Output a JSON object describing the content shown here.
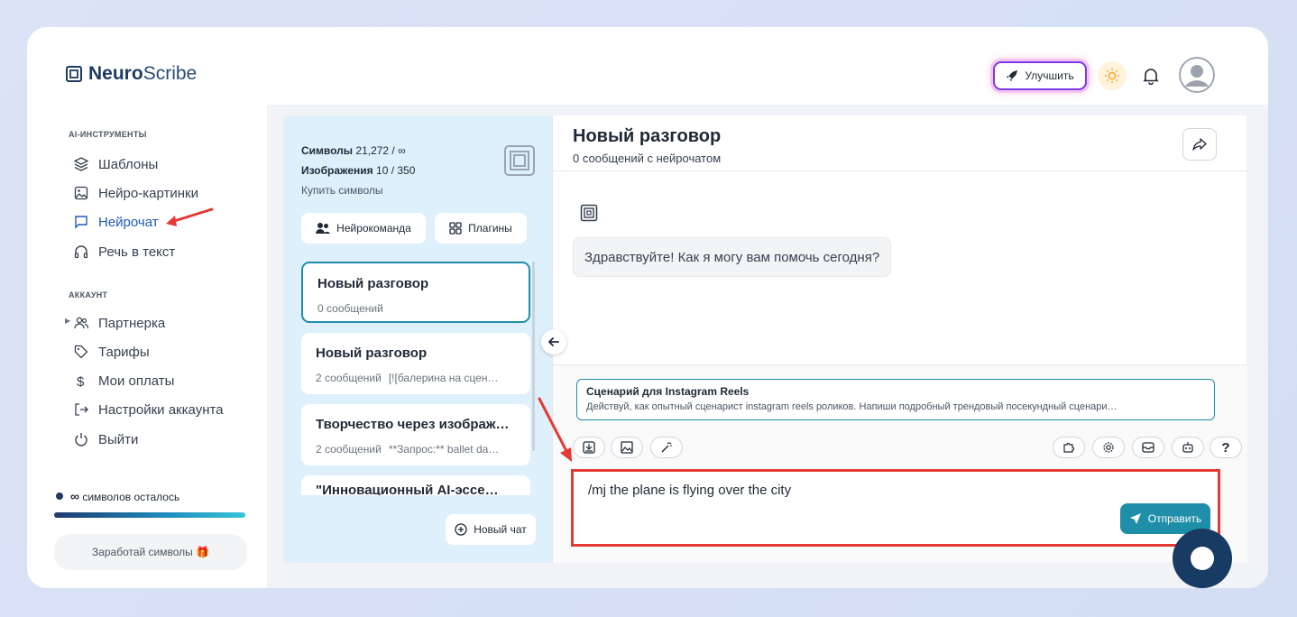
{
  "brand": {
    "bold": "Neuro",
    "rest": "Scribe"
  },
  "header": {
    "upgrade_label": "Улучшить"
  },
  "sidebar": {
    "ai_section": "AI-ИНСТРУМЕНТЫ",
    "ai_items": [
      {
        "label": "Шаблоны",
        "icon": "layers-icon"
      },
      {
        "label": "Нейро-картинки",
        "icon": "image-icon"
      },
      {
        "label": "Нейрочат",
        "icon": "chat-icon",
        "active": true
      },
      {
        "label": "Речь в текст",
        "icon": "headphones-icon"
      }
    ],
    "account_section": "АККАУНТ",
    "account_items": [
      {
        "label": "Партнерка",
        "icon": "users-icon"
      },
      {
        "label": "Тарифы",
        "icon": "tag-icon"
      },
      {
        "label": "Мои оплаты",
        "icon": "dollar-icon"
      },
      {
        "label": "Настройки аккаунта",
        "icon": "login-icon"
      },
      {
        "label": "Выйти",
        "icon": "power-icon"
      }
    ],
    "symbols_left_value": "∞",
    "symbols_left_label": "символов осталось",
    "earn_label": "Заработай символы 🎁"
  },
  "stats": {
    "symbols_label": "Символы",
    "symbols_value": "21,272 / ∞",
    "images_label": "Изображения",
    "images_value": "10 / 350",
    "buy_label": "Купить символы"
  },
  "list_panel": {
    "team_label": "Нейрокоманда",
    "plugins_label": "Плагины",
    "new_chat_label": "Новый чат",
    "chats": [
      {
        "title": "Новый разговор",
        "count": "0 сообщений",
        "preview": ""
      },
      {
        "title": "Новый разговор",
        "count": "2 сообщений",
        "preview": "[![балерина на сцен…"
      },
      {
        "title": "Творчество через изображ…",
        "count": "2 сообщений",
        "preview": "**Запрос:** ballet da…"
      },
      {
        "title": "\"Инновационный AI-эссе…",
        "count": "",
        "preview": ""
      }
    ]
  },
  "chat": {
    "title": "Новый разговор",
    "subtitle": "0 сообщений с нейрочатом",
    "greeting": "Здравствуйте! Как я могу вам помочь сегодня?",
    "template_title": "Сценарий для Instagram Reels",
    "template_desc": "Действуй, как опытный сценарист instagram reels роликов. Напиши подробный трендовый посекундный сценари…",
    "input_value": "/mj the plane is flying over the city",
    "send_label": "Отправить",
    "help_label": "?"
  },
  "colors": {
    "accent": "#1f8ea8",
    "highlight": "#e53935",
    "panel": "#def0fb",
    "upgrade_border": "#7c3aed"
  }
}
